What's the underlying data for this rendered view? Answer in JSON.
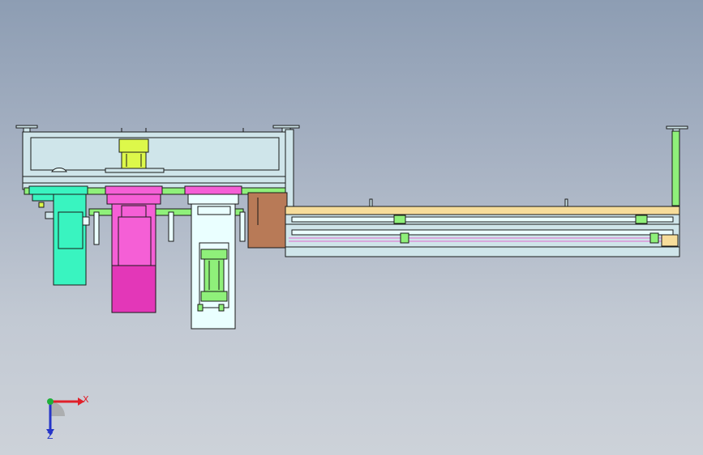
{
  "triad": {
    "x_label": "X",
    "z_label": "Z",
    "x_color": "#e0202a",
    "z_color": "#2535c8",
    "y_color": "#1fb03a"
  },
  "colors": {
    "frame": "#cfe5ea",
    "outline": "#1a1a1a",
    "teal": "#39f4c0",
    "magenta": "#f55fd6",
    "magenta_dark": "#e337b8",
    "yellow_green": "#ddf84a",
    "green": "#8ff07a",
    "light": "#eaffff",
    "brown": "#b87a57",
    "belt_top": "#f7dd9a",
    "pink_line": "#e06fd0"
  }
}
